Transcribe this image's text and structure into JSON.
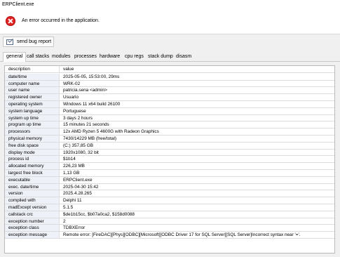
{
  "window": {
    "title": "ERPClient.exe"
  },
  "error": {
    "message": "An error occurred in the application.",
    "icon": "error-icon"
  },
  "bug_report": {
    "label": "send bug report",
    "icon": "send-report-icon"
  },
  "tabs": [
    {
      "label": "general",
      "active": true
    },
    {
      "label": "call stacks"
    },
    {
      "label": "modules"
    },
    {
      "label": "processes"
    },
    {
      "label": "hardware"
    },
    {
      "label": "cpu regs"
    },
    {
      "label": "stack dump"
    },
    {
      "label": "disasm"
    }
  ],
  "table": {
    "header": {
      "key": "description",
      "value": "value"
    },
    "rows": [
      {
        "key": "date/time",
        "value": "2025-05-05, 15:53:00, 29ms"
      },
      {
        "key": "computer name",
        "value": "WRK-02"
      },
      {
        "key": "user name",
        "value": "patricia.sena  <admin>"
      },
      {
        "key": "registered owner",
        "value": "Usuario"
      },
      {
        "key": "operating system",
        "value": "Windows 11 x64 build 26100"
      },
      {
        "key": "system language",
        "value": "Portuguese"
      },
      {
        "key": "system up time",
        "value": "3 days 2 hours"
      },
      {
        "key": "program up time",
        "value": "15 minutes 21 seconds"
      },
      {
        "key": "processors",
        "value": "12x AMD Ryzen 5 4600G with Radeon Graphics"
      },
      {
        "key": "physical memory",
        "value": "7430/14229 MB (free/total)"
      },
      {
        "key": "free disk space",
        "value": "(C:) 357,85 GB"
      },
      {
        "key": "display mode",
        "value": "1920x1080, 32 bit"
      },
      {
        "key": "process id",
        "value": "$1b14"
      },
      {
        "key": "allocated memory",
        "value": "226,23 MB"
      },
      {
        "key": "largest free block",
        "value": "1,13 GB"
      },
      {
        "key": "executable",
        "value": "ERPClient.exe"
      },
      {
        "key": "exec. date/time",
        "value": "2025-04-30 15:42"
      },
      {
        "key": "version",
        "value": "2025.4.28.265"
      },
      {
        "key": "compiled with",
        "value": "Delphi 11"
      },
      {
        "key": "madExcept version",
        "value": "5.1.5"
      },
      {
        "key": "callstack crc",
        "value": "$de1b15cc, $b07a0ca2, $158d0088"
      },
      {
        "key": "exception number",
        "value": "2"
      },
      {
        "key": "exception class",
        "value": "TDBXError"
      },
      {
        "key": "exception message",
        "value": "Remote error: [FireDAC][Phys][ODBC][Microsoft][ODBC Driver 17 for SQL Server][SQL Server]Incorrect syntax near '='."
      }
    ]
  }
}
